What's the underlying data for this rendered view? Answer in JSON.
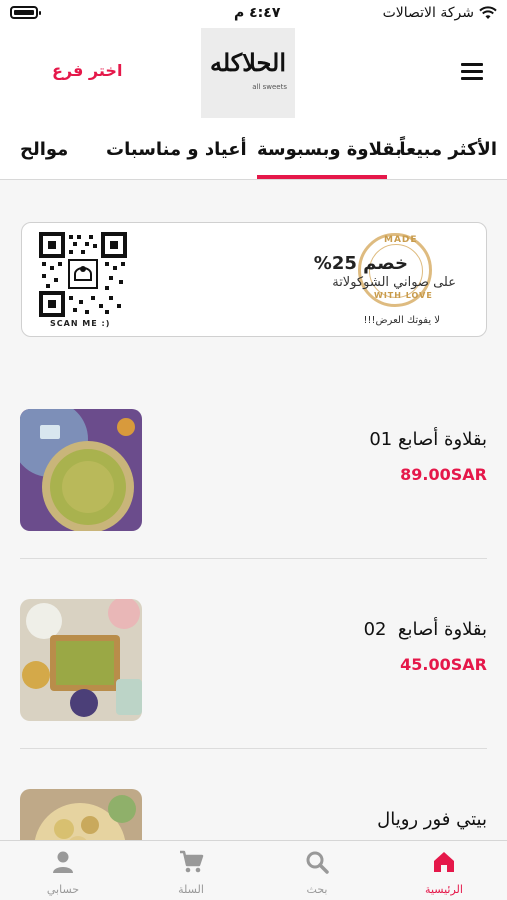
{
  "status_bar": {
    "carrier": "شركة الاتصالات",
    "time": "٤:٤٧ م"
  },
  "header": {
    "choose_branch": "اختر فرع",
    "logo_text": "الحلاكله",
    "logo_sub": "all sweets"
  },
  "tabs": [
    {
      "label": "الأكثر مبيعاً"
    },
    {
      "label": "بقلاوة وبسبوسة",
      "selected": true
    },
    {
      "label": "أعياد و مناسبات"
    },
    {
      "label": "موالح"
    }
  ],
  "banner": {
    "title": "خصم 25%",
    "subtitle": "على صواني الشوكولاتة",
    "note": "لا يفوتك العرض!!!",
    "scan_label": "SCAN ME :)",
    "stamp_top": "MADE",
    "stamp_bottom": "WITH LOVE"
  },
  "products": [
    {
      "name": "بقلاوة أصابع 01",
      "price": "89.00SAR"
    },
    {
      "name": "بقلاوة أصابع  02",
      "price": "45.00SAR"
    },
    {
      "name": "بيتي فور رويال",
      "price": ""
    }
  ],
  "bottom_nav": [
    {
      "label": "الرئيسية",
      "icon": "home-icon",
      "active": true
    },
    {
      "label": "بحث",
      "icon": "search-icon"
    },
    {
      "label": "السلة",
      "icon": "cart-icon"
    },
    {
      "label": "حسابي",
      "icon": "account-icon"
    }
  ],
  "colors": {
    "accent": "#e5184a",
    "stamp": "#d9b06a"
  }
}
